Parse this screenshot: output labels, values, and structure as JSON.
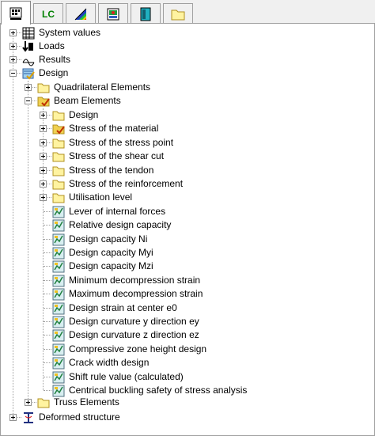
{
  "tabs": [
    {
      "name": "tab-system",
      "icon": "system-values-icon",
      "active": true
    },
    {
      "name": "tab-lc",
      "label": "LC",
      "active": false
    },
    {
      "name": "tab-colors",
      "icon": "color-scale-icon",
      "active": false
    },
    {
      "name": "tab-view",
      "icon": "view-icon",
      "active": false
    },
    {
      "name": "tab-panel",
      "icon": "panel-icon",
      "active": false
    },
    {
      "name": "tab-folder",
      "icon": "folder-icon",
      "active": false
    }
  ],
  "tree": {
    "system_values": "System values",
    "loads": "Loads",
    "results": "Results",
    "design": "Design",
    "quadrilateral": "Quadrilateral Elements",
    "beam": "Beam Elements",
    "beam_children": [
      {
        "label": "Design",
        "icon": "folder",
        "expander": "plus"
      },
      {
        "label": "Stress of the material",
        "icon": "folder-check",
        "expander": "plus"
      },
      {
        "label": "Stress of the stress point",
        "icon": "folder",
        "expander": "plus"
      },
      {
        "label": "Stress of the shear cut",
        "icon": "folder",
        "expander": "plus"
      },
      {
        "label": "Stress of the tendon",
        "icon": "folder",
        "expander": "plus"
      },
      {
        "label": "Stress of the reinforcement",
        "icon": "folder",
        "expander": "plus"
      },
      {
        "label": "Utilisation level",
        "icon": "folder",
        "expander": "plus"
      },
      {
        "label": "Lever of internal forces",
        "icon": "result",
        "expander": null
      },
      {
        "label": "Relative design capacity",
        "icon": "result",
        "expander": null
      },
      {
        "label": "Design capacity Ni",
        "icon": "result",
        "expander": null
      },
      {
        "label": "Design capacity Myi",
        "icon": "result",
        "expander": null
      },
      {
        "label": "Design capacity Mzi",
        "icon": "result",
        "expander": null
      },
      {
        "label": "Minimum decompression strain",
        "icon": "result",
        "expander": null
      },
      {
        "label": "Maximum decompression strain",
        "icon": "result",
        "expander": null
      },
      {
        "label": "Design strain at center e0",
        "icon": "result",
        "expander": null
      },
      {
        "label": "Design curvature y direction ey",
        "icon": "result",
        "expander": null
      },
      {
        "label": "Design curvature z direction ez",
        "icon": "result",
        "expander": null
      },
      {
        "label": "Compressive zone height design",
        "icon": "result",
        "expander": null
      },
      {
        "label": "Crack width design",
        "icon": "result",
        "expander": null
      },
      {
        "label": "Shift rule value (calculated)",
        "icon": "result",
        "expander": null
      },
      {
        "label": "Centrical buckling safety of stress analysis",
        "icon": "result",
        "expander": null
      }
    ],
    "truss": "Truss Elements",
    "deformed": "Deformed structure"
  }
}
